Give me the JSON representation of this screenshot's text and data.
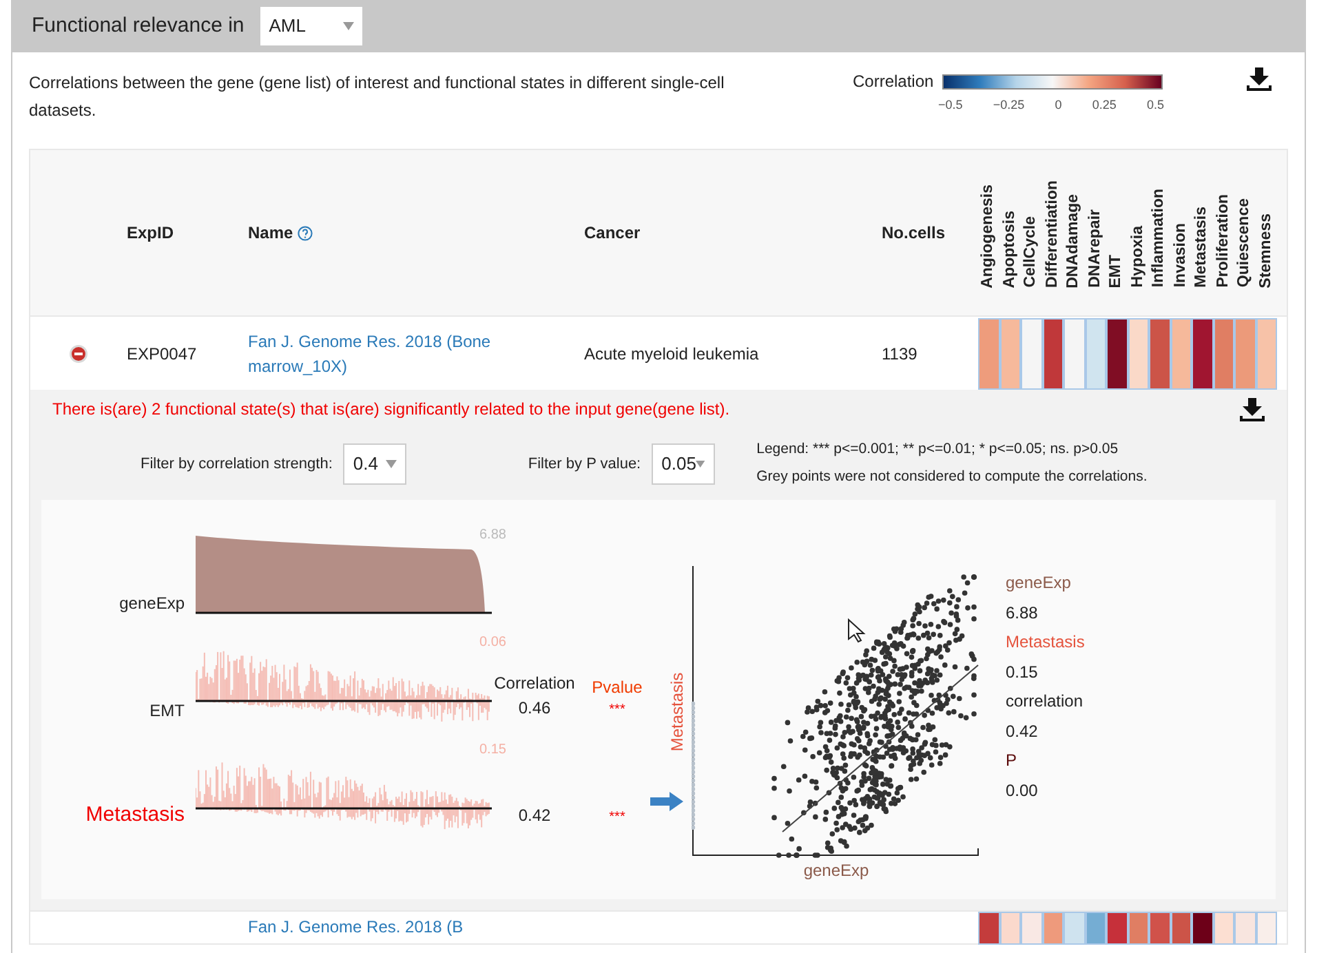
{
  "header": {
    "title": "Functional relevance in",
    "dataset_select": "AML"
  },
  "description": "Correlations between the gene (gene list) of interest and functional states in different single-cell datasets.",
  "legend": {
    "title": "Correlation",
    "ticks": [
      "−0.5",
      "−0.25",
      "0",
      "0.25",
      "0.5"
    ]
  },
  "table": {
    "columns": [
      "ExpID",
      "Name",
      "Cancer",
      "No.cells"
    ],
    "states": [
      "Angiogenesis",
      "Apoptosis",
      "CellCycle",
      "Differentiation",
      "DNAdamage",
      "DNArepair",
      "EMT",
      "Hypoxia",
      "Inflammation",
      "Invasion",
      "Metastasis",
      "Proliferation",
      "Quiescence",
      "Stemness"
    ],
    "rows": [
      {
        "expanded": true,
        "exp_id": "EXP0047",
        "name": "Fan J. Genome Res. 2018 (Bone marrow_10X)",
        "cancer": "Acute myeloid leukemia",
        "cells": "1139",
        "heat": [
          {
            "color": "#ee9c7c"
          },
          {
            "color": "#f6b99b"
          },
          {
            "color": "#f5f5f5"
          },
          {
            "color": "#c0383a"
          },
          {
            "color": "#f5f5f5"
          },
          {
            "color": "#d0e4ef"
          },
          {
            "color": "#800d24"
          },
          {
            "color": "#fad9c8"
          },
          {
            "color": "#cc5448"
          },
          {
            "color": "#f6b99b"
          },
          {
            "color": "#a01530"
          },
          {
            "color": "#e07e63"
          },
          {
            "color": "#ec9a7a"
          },
          {
            "color": "#f7c2a8"
          }
        ]
      },
      {
        "expanded": false,
        "name": "Fan J. Genome Res. 2018 (B",
        "heat": [
          {
            "color": "#c43c3c"
          },
          {
            "color": "#fbd9cc"
          },
          {
            "color": "#f9e8e4"
          },
          {
            "color": "#ee9a7c"
          },
          {
            "color": "#cfe3ef"
          },
          {
            "color": "#75add3"
          },
          {
            "color": "#c6303a"
          },
          {
            "color": "#e07e63"
          },
          {
            "color": "#d0524a"
          },
          {
            "color": "#cc5448"
          },
          {
            "color": "#6d0018"
          },
          {
            "color": "#fcdfd2"
          },
          {
            "color": "#f8e5df"
          },
          {
            "color": "#f9eeea"
          }
        ]
      }
    ]
  },
  "detail": {
    "message": "There is(are) 2 functional state(s) that is(are) significantly related to the input gene(gene list).",
    "filters": [
      {
        "label": "Filter by correlation strength:",
        "value": "0.4"
      },
      {
        "label": "Filter by P value:",
        "value": "0.05"
      }
    ],
    "legend_lines": [
      "Legend: *** p<=0.001; ** p<=0.01; * p<=0.05; ns. p>0.05",
      "Grey points were not considered to compute the correlations."
    ],
    "headers": [
      "Correlation",
      "Pvalue"
    ],
    "traces": [
      {
        "kind": "area",
        "label": "geneExp",
        "max": "6.88",
        "selected": false
      },
      {
        "kind": "bars",
        "label": "EMT",
        "max": "0.06",
        "correlation": "0.46",
        "pvalue": "***",
        "selected": false
      },
      {
        "kind": "bars",
        "label": "Metastasis",
        "max": "0.15",
        "correlation": "0.42",
        "pvalue": "***",
        "selected": true
      }
    ],
    "scatter": {
      "xlabel": "geneExp",
      "ylabel": "Metastasis"
    },
    "info": [
      {
        "label": "geneExp",
        "value": "6.88",
        "color": "#8b5a4a"
      },
      {
        "label": "Metastasis",
        "value": "0.15",
        "color": "#e5533d"
      },
      {
        "label": "correlation",
        "value": "0.42",
        "color": "#222222"
      },
      {
        "label": "P",
        "value": "0.00",
        "color": "#5a0a0a"
      }
    ]
  }
}
